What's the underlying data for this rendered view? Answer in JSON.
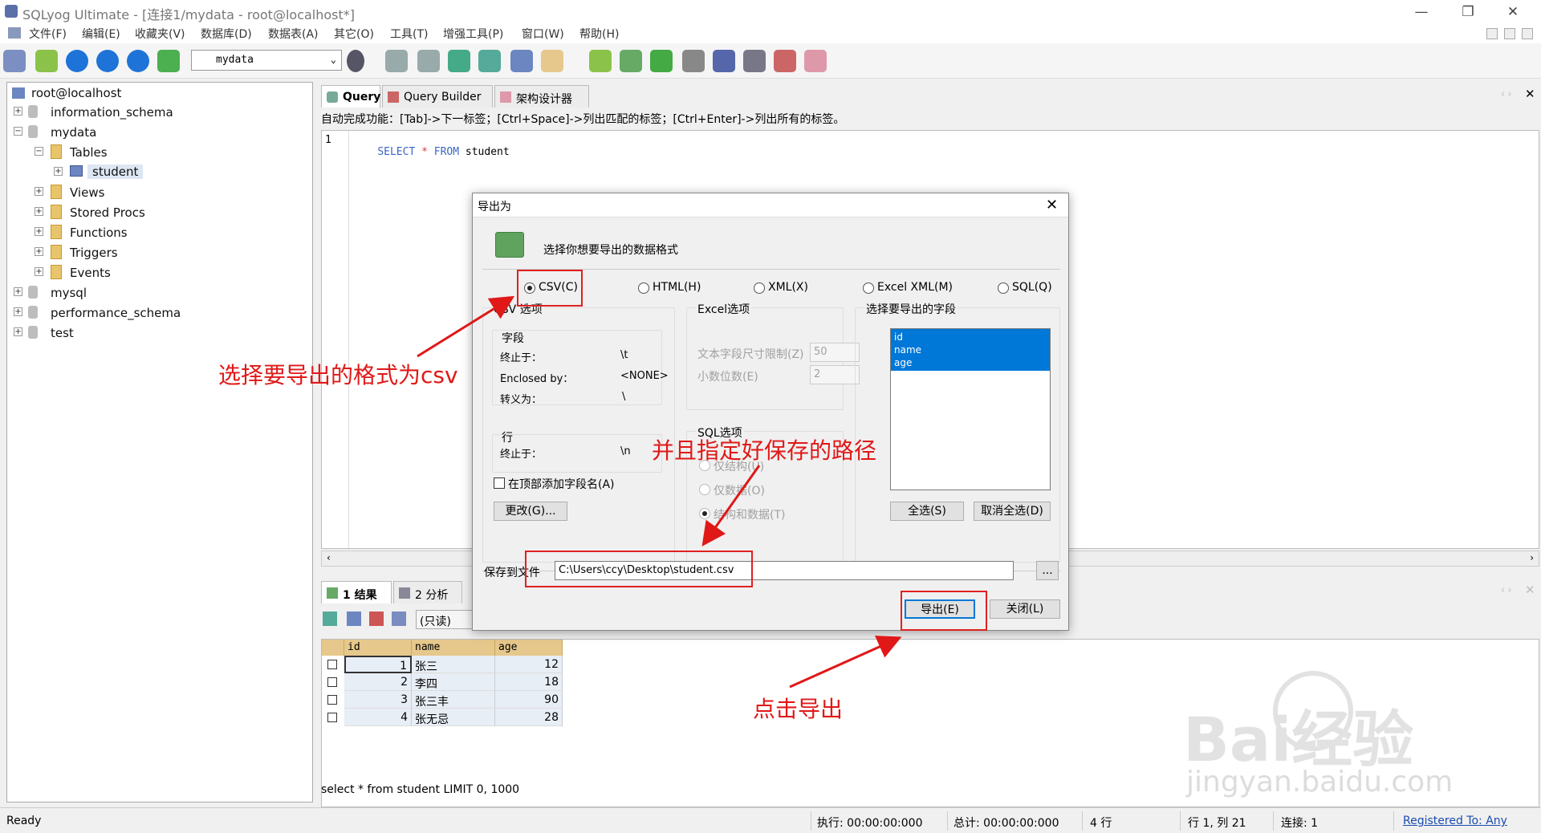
{
  "app": {
    "title": "SQLyog Ultimate - [连接1/mydata - root@localhost*]"
  },
  "window_controls": {
    "minimize": "—",
    "restore": "❐",
    "close": "✕"
  },
  "menu": [
    "文件(F)",
    "编辑(E)",
    "收藏夹(V)",
    "数据库(D)",
    "数据表(A)",
    "其它(O)",
    "工具(T)",
    "增强工具(P)",
    "窗口(W)",
    "帮助(H)"
  ],
  "toolbar": {
    "db_select": "mydata"
  },
  "tree": {
    "root": "root@localhost",
    "items": [
      "information_schema",
      "mydata",
      "Tables",
      "student",
      "Views",
      "Stored Procs",
      "Functions",
      "Triggers",
      "Events",
      "mysql",
      "performance_schema",
      "test"
    ]
  },
  "tabs": [
    "Query",
    "Query Builder",
    "架构设计器"
  ],
  "hint": "自动完成功能：[Tab]->下一标签；[Ctrl+Space]->列出匹配的标签；[Ctrl+Enter]->列出所有的标签。",
  "editor": {
    "line_no": "1",
    "kw1": "SELECT",
    "star": "*",
    "kw2": "FROM",
    "table": "student"
  },
  "result_tabs": [
    "1 结果",
    "2 分析"
  ],
  "readonly": "(只读)",
  "grid": {
    "columns": [
      "id",
      "name",
      "age"
    ],
    "rows": [
      [
        "1",
        "张三",
        "12"
      ],
      [
        "2",
        "李四",
        "18"
      ],
      [
        "3",
        "张三丰",
        "90"
      ],
      [
        "4",
        "张无忌",
        "28"
      ]
    ]
  },
  "sql_bar": "select * from student  LIMIT 0, 1000",
  "status": {
    "ready": "Ready",
    "exec": "执行: 00:00:00:000",
    "total": "总计: 00:00:00:000",
    "rows": "4 行",
    "pos": "行 1, 列 21",
    "conn": "连接: 1",
    "registered": "Registered To: Any"
  },
  "dialog": {
    "title": "导出为",
    "heading": "选择你想要导出的数据格式",
    "formats": [
      "CSV(C)",
      "HTML(H)",
      "XML(X)",
      "Excel XML(M)",
      "SQL(Q)"
    ],
    "csv_group": "CSV 选项",
    "field_label": "字段",
    "terminated": "终止于：",
    "terminated_val": "\\t",
    "enclosed": "Enclosed by：",
    "enclosed_val": "<NONE>",
    "escaped": "转义为：",
    "escaped_val": "\\",
    "line_label": "行",
    "line_term": "终止于：",
    "line_term_val": "\\n",
    "add_header": "在顶部添加字段名(A)",
    "change_btn": "更改(G)...",
    "excel_group": "Excel选项",
    "text_limit": "文本字段尺寸限制(Z)",
    "text_limit_val": "50",
    "decimals": "小数位数(E)",
    "decimals_val": "2",
    "sql_group": "SQL选项",
    "sql_opts": [
      "仅结构(U)",
      "仅数据(O)",
      "结构和数据(T)"
    ],
    "fields_group": "选择要导出的字段",
    "fields": [
      "id",
      "name",
      "age"
    ],
    "select_all": "全选(S)",
    "deselect_all": "取消全选(D)",
    "save_label": "保存到文件",
    "save_path": "C:\\Users\\ccy\\Desktop\\student.csv",
    "browse": "...",
    "export_btn": "导出(E)",
    "close_btn": "关闭(L)"
  },
  "annotations": {
    "choose_csv": "选择要导出的格式为csv",
    "set_path": "并且指定好保存的路径",
    "click_export": "点击导出"
  },
  "watermark": {
    "logo": "Bai经验",
    "url": "jingyan.baidu.com"
  },
  "colors": {
    "annotation": "#e01818",
    "selection": "#0078d7",
    "header": "#e6c88c"
  }
}
